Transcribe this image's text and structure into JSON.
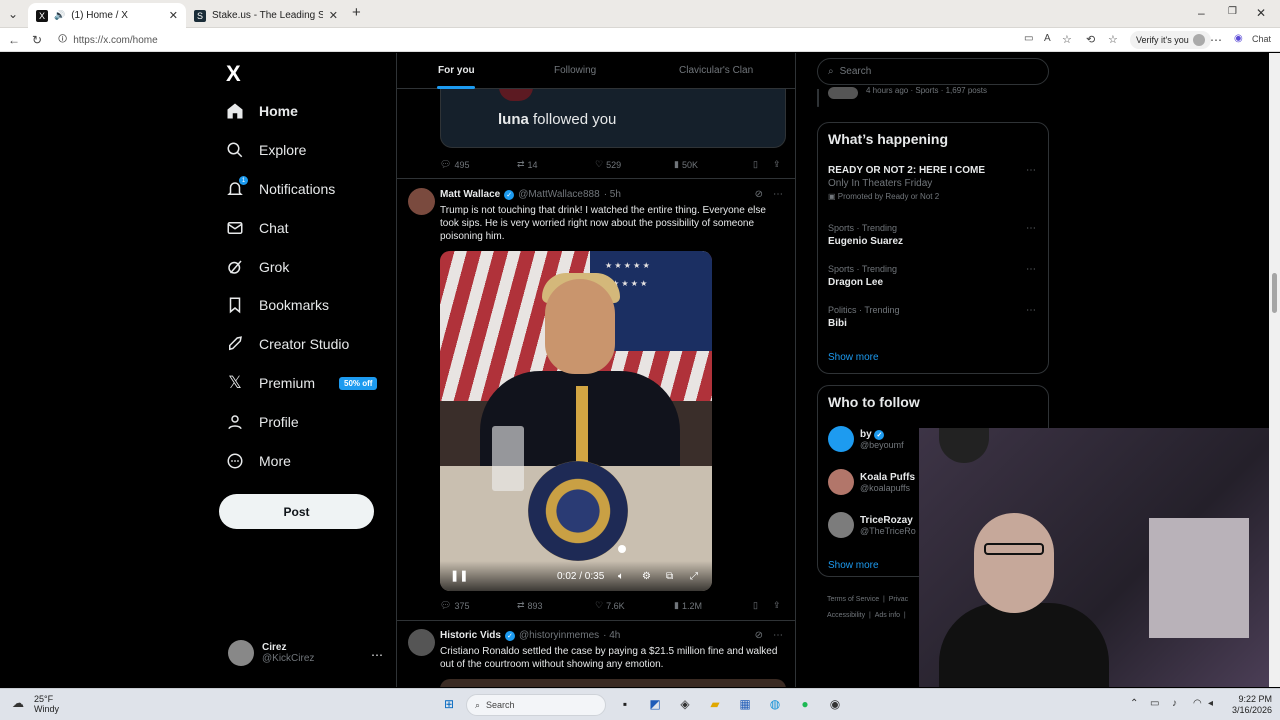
{
  "browser": {
    "tabs": [
      {
        "title": "(1) Home / X",
        "active": true,
        "favicon": "x-logo"
      },
      {
        "title": "Stake.us - The Leading Social Casino",
        "active": false,
        "favicon": "stake-logo"
      }
    ],
    "url": "https://x.com/home",
    "verify_label": "Verify it's you",
    "chat_label": "Chat"
  },
  "nav": {
    "logo": "X",
    "items": [
      {
        "label": "Home",
        "icon": "home-icon"
      },
      {
        "label": "Explore",
        "icon": "search-icon"
      },
      {
        "label": "Notifications",
        "icon": "bell-icon",
        "badge": "1"
      },
      {
        "label": "Chat",
        "icon": "mail-icon"
      },
      {
        "label": "Grok",
        "icon": "grok-icon"
      },
      {
        "label": "Bookmarks",
        "icon": "bookmark-icon"
      },
      {
        "label": "Creator Studio",
        "icon": "rocket-icon"
      },
      {
        "label": "Premium",
        "icon": "x-icon",
        "pill": "50% off"
      },
      {
        "label": "Profile",
        "icon": "person-icon"
      },
      {
        "label": "More",
        "icon": "more-circle-icon"
      }
    ],
    "post_label": "Post",
    "account": {
      "name": "Cirez",
      "handle": "@KickCirez"
    }
  },
  "feed": {
    "tabs": [
      "For you",
      "Following",
      "Clavicular's Clan"
    ],
    "quote": {
      "name": "luna",
      "text": "followed you"
    },
    "post0_stats": {
      "replies": "495",
      "reposts": "14",
      "likes": "529",
      "views": "50K"
    },
    "post1": {
      "name": "Matt Wallace",
      "handle": "@MattWallace888",
      "time": "· 5h",
      "text": "Trump is not touching that drink! I watched the entire thing. Everyone else took sips. He is very worried right now about the possibility of someone poisoning him.",
      "video_time": "0:02 / 0:35",
      "stats": {
        "replies": "375",
        "reposts": "893",
        "likes": "7.6K",
        "views": "1.2M"
      }
    },
    "post2": {
      "name": "Historic Vids",
      "handle": "@historyinmemes",
      "time": "· 4h",
      "text": "Cristiano Ronaldo settled the case by paying a $21.5 million fine and walked out of the courtroom without showing any emotion."
    }
  },
  "sidebar": {
    "search_placeholder": "Search",
    "top_snippet": "4 hours ago · Sports · 1,697 posts",
    "happening_title": "What’s happening",
    "trends": [
      {
        "meta": "",
        "title": "READY OR NOT 2: HERE I COME",
        "sub": "Only In Theaters Friday",
        "promo": "Promoted by Ready or Not 2"
      },
      {
        "meta": "Sports · Trending",
        "title": "Eugenio Suarez"
      },
      {
        "meta": "Sports · Trending",
        "title": "Dragon Lee"
      },
      {
        "meta": "Politics · Trending",
        "title": "Bibi"
      }
    ],
    "show_more": "Show more",
    "follow_title": "Who to follow",
    "follows": [
      {
        "name": "by",
        "handle": "@beyoumf"
      },
      {
        "name": "Koala Puffs",
        "handle": "@koalapuffs"
      },
      {
        "name": "TriceRozay",
        "handle": "@TheTriceRo"
      }
    ],
    "footer": [
      "Terms of Service",
      "|",
      "Privac",
      "Accessibility",
      "|",
      "Ads info",
      "|"
    ]
  },
  "taskbar": {
    "temp": "25°F",
    "weather": "Windy",
    "search_label": "Search",
    "time": "9:22 PM",
    "date": "3/16/2026"
  }
}
